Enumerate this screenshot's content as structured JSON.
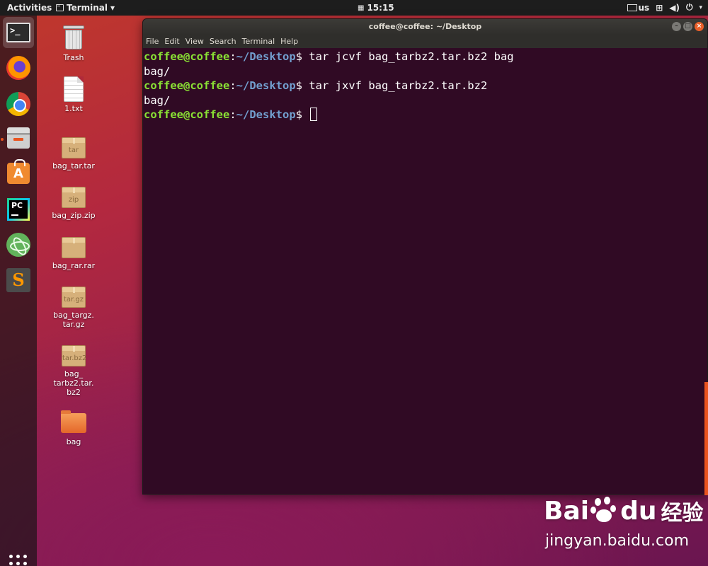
{
  "topbar": {
    "activities": "Activities",
    "app_menu": "Terminal",
    "clock": "15:15",
    "keyboard_layout": "us"
  },
  "dock": {
    "items": [
      "terminal-icon",
      "firefox-icon",
      "chrome-icon",
      "files-icon",
      "software-center-icon",
      "pycharm-icon",
      "atom-icon",
      "sublime-text-icon"
    ],
    "terminal_glyph": ">_",
    "pycharm_glyph": "PC",
    "sublime_glyph": "S"
  },
  "desktop": {
    "trash": "Trash",
    "file_1": "1.txt",
    "bag_tar": {
      "label": "bag_tar.tar",
      "badge": "tar"
    },
    "bag_zip": {
      "label": "bag_zip.zip",
      "badge": "zip"
    },
    "bag_rar": {
      "label": "bag_rar.rar",
      "badge": ""
    },
    "bag_targz": {
      "label_line1": "bag_targz.",
      "label_line2": "tar.gz",
      "badge": "tar.gz"
    },
    "bag_tarbz2": {
      "label_line1": "bag_",
      "label_line2": "tarbz2.tar.",
      "label_line3": "bz2",
      "badge": "tar.bz2"
    },
    "bag_folder": "bag"
  },
  "terminal": {
    "title": "coffee@coffee: ~/Desktop",
    "menu": [
      "File",
      "Edit",
      "View",
      "Search",
      "Terminal",
      "Help"
    ],
    "prompt_user": "coffee@coffee",
    "prompt_sep": ":",
    "prompt_path": "~/Desktop",
    "prompt_symbol": "$",
    "lines": [
      {
        "type": "cmd",
        "text": " tar jcvf bag_tarbz2.tar.bz2 bag"
      },
      {
        "type": "out",
        "text": "bag/"
      },
      {
        "type": "cmd",
        "text": " tar jxvf bag_tarbz2.tar.bz2"
      },
      {
        "type": "out",
        "text": "bag/"
      },
      {
        "type": "cmd",
        "text": " "
      }
    ]
  },
  "watermark": {
    "brand_a": "Bai",
    "brand_b": "du",
    "brand_cn": "经验",
    "url": "jingyan.baidu.com"
  },
  "colors": {
    "terminal_bg": "#300a24",
    "prompt_user": "#8ae234",
    "prompt_path": "#729fcf",
    "accent": "#e95420"
  }
}
